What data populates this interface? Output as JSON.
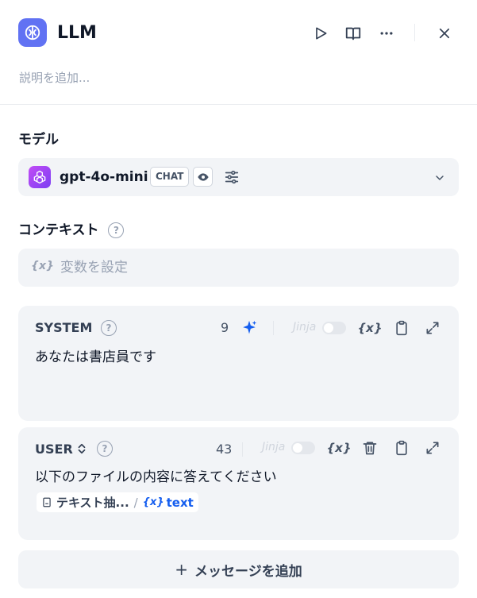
{
  "header": {
    "title": "LLM",
    "description_placeholder": "説明を追加...",
    "icons": {
      "app": "llm-brain-icon",
      "run": "play-icon",
      "docs": "book-icon",
      "more": "more-horizontal-icon",
      "close": "close-icon"
    }
  },
  "model_section": {
    "label": "モデル",
    "model_name": "gpt-4o-mini",
    "mode_badge": "CHAT",
    "icons": {
      "logo": "openai-logo-icon",
      "vision": "eye-icon",
      "settings": "sliders-icon",
      "dropdown": "chevron-down-icon"
    }
  },
  "context_section": {
    "label": "コンテキスト",
    "var_icon": "{x}",
    "placeholder": "変数を設定"
  },
  "system_prompt": {
    "role": "SYSTEM",
    "char_count": "9",
    "jinja_label": "Jinja",
    "jinja_enabled": false,
    "var_icon": "{x}",
    "text": "あなたは書店員です",
    "icons": {
      "help": "help-circle-icon",
      "generate": "sparkle-icon",
      "insert_var": "variable-icon",
      "copy": "clipboard-icon",
      "expand": "expand-icon"
    }
  },
  "user_prompt": {
    "role": "USER",
    "char_count": "43",
    "jinja_label": "Jinja",
    "jinja_enabled": false,
    "var_icon": "{x}",
    "text": "以下のファイルの内容に答えてください",
    "variable_ref": {
      "node_label": "テキスト抽...",
      "separator": "/",
      "var_icon": "{x}",
      "var_name": "text"
    },
    "icons": {
      "role_switch": "chevron-updown-icon",
      "help": "help-circle-icon",
      "insert_var": "variable-icon",
      "delete": "trash-icon",
      "copy": "clipboard-icon",
      "expand": "expand-icon"
    }
  },
  "add_message": {
    "plus": "+",
    "label": "メッセージを追加"
  },
  "colors": {
    "accent": "#6172f3",
    "link_blue": "#155eef",
    "panel_bg": "#f2f4f7"
  }
}
